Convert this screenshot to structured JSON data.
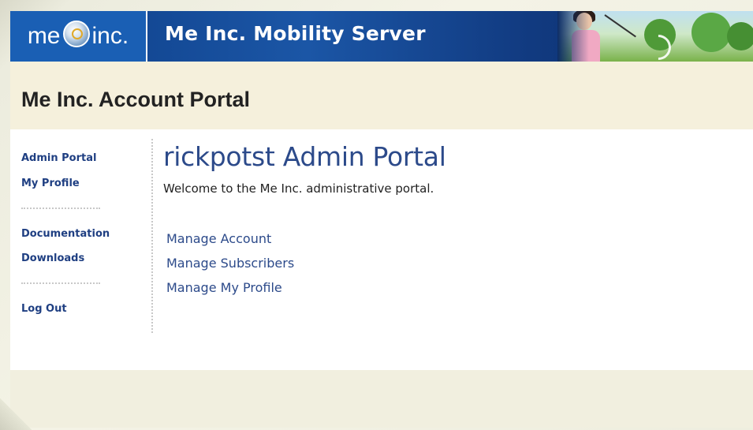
{
  "header": {
    "logo_left": "me",
    "logo_right": "inc.",
    "banner_title": "Me Inc. Mobility Server"
  },
  "title_bar": {
    "title": "Me Inc. Account Portal"
  },
  "sidebar": {
    "items": [
      {
        "label": "Admin Portal"
      },
      {
        "label": "My Profile"
      },
      {
        "label": "Documentation"
      },
      {
        "label": "Downloads"
      },
      {
        "label": "Log Out"
      }
    ]
  },
  "main": {
    "title": "rickpotst Admin Portal",
    "welcome": "Welcome to the Me Inc. administrative portal.",
    "links": [
      {
        "label": "Manage Account"
      },
      {
        "label": "Manage Subscribers"
      },
      {
        "label": "Manage My Profile"
      }
    ]
  },
  "colors": {
    "banner_blue": "#1a5fb4",
    "link_navy": "#1f3f82",
    "title_blue": "#2c4a8a",
    "title_bar_bg": "#f5f0dc"
  },
  "icons": {
    "logo": "globe-logo-icon",
    "banner_image": "woman-kite-photo"
  }
}
